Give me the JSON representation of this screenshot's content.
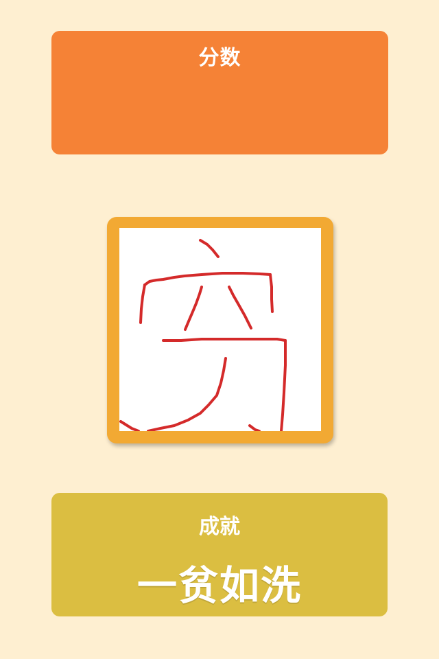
{
  "score_panel": {
    "label": "分数",
    "value": ""
  },
  "drawing": {
    "ink_color": "#D42A2A",
    "frame_color": "#F2A933"
  },
  "achievement_panel": {
    "label": "成就",
    "title": "一贫如洗"
  },
  "colors": {
    "background": "#FEEFD1",
    "score_panel": "#F58236",
    "achievement_panel": "#DBBE41"
  }
}
